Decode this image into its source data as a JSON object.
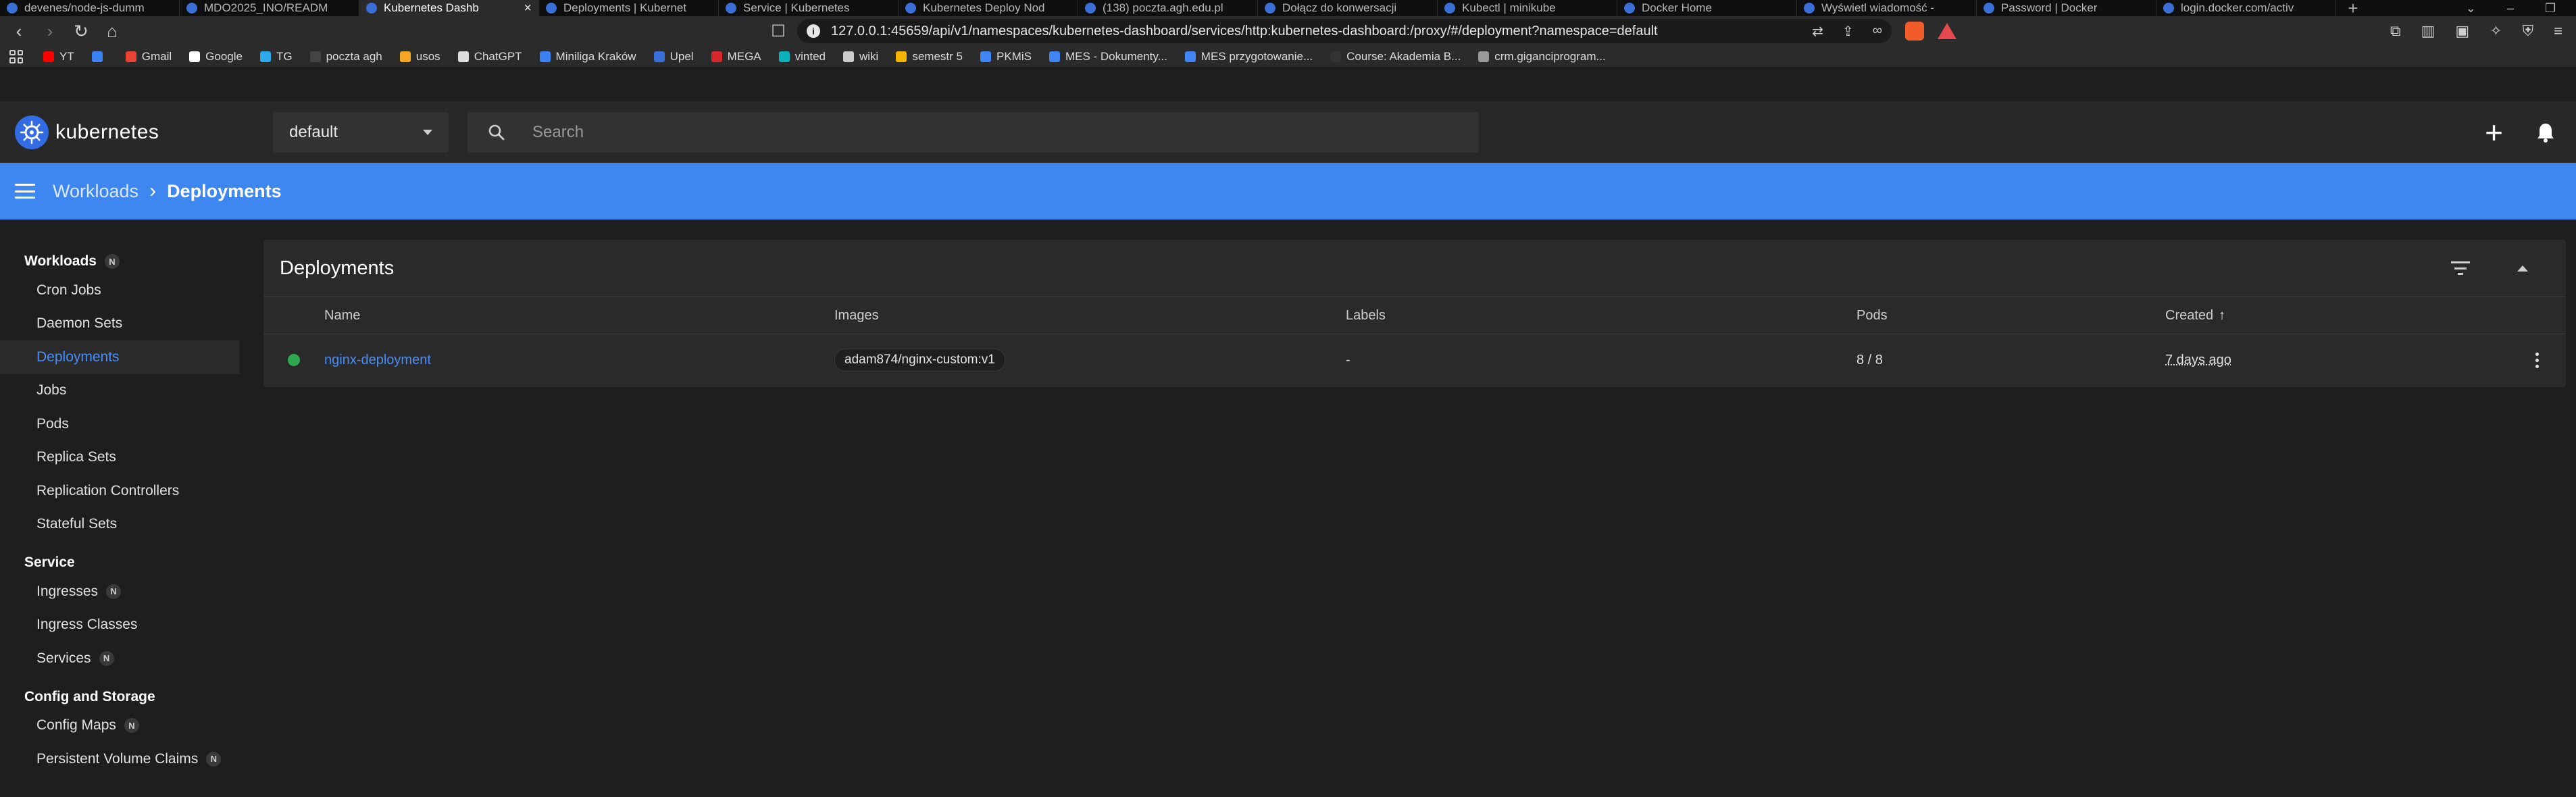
{
  "browser": {
    "tabs": [
      {
        "label": "devenes/node-js-dumm"
      },
      {
        "label": "MDO2025_INO/READM"
      },
      {
        "label": "Kubernetes Dashb",
        "active": true
      },
      {
        "label": "Deployments | Kubernet"
      },
      {
        "label": "Service | Kubernetes"
      },
      {
        "label": "Kubernetes Deploy Nod"
      },
      {
        "label": "(138) poczta.agh.edu.pl"
      },
      {
        "label": "Dołącz do konwersacji"
      },
      {
        "label": "Kubectl | minikube"
      },
      {
        "label": "Docker Home"
      },
      {
        "label": "Wyświetl wiadomość - "
      },
      {
        "label": "Password | Docker"
      },
      {
        "label": "login.docker.com/activ"
      }
    ],
    "tab_close_glyph": "×",
    "new_tab_glyph": "+",
    "url": "127.0.0.1:45659/api/v1/namespaces/kubernetes-dashboard/services/http:kubernetes-dashboard:/proxy/#/deployment?namespace=default",
    "bookmarks": [
      {
        "label": "YT",
        "color": "#ff0000"
      },
      {
        "label": "",
        "color": "#3b82f6"
      },
      {
        "label": "Gmail",
        "color": "#ea4335"
      },
      {
        "label": "Google",
        "color": "#ffffff"
      },
      {
        "label": "TG",
        "color": "#2aabee"
      },
      {
        "label": "poczta agh",
        "color": "#444444"
      },
      {
        "label": "usos",
        "color": "#f5a623"
      },
      {
        "label": "ChatGPT",
        "color": "#dddddd"
      },
      {
        "label": "Miniliga Kraków",
        "color": "#3b82f6"
      },
      {
        "label": "Upel",
        "color": "#3b6fd8"
      },
      {
        "label": "MEGA",
        "color": "#d9272e"
      },
      {
        "label": "vinted",
        "color": "#09b1ba"
      },
      {
        "label": "wiki",
        "color": "#cccccc"
      },
      {
        "label": "semestr 5",
        "color": "#f4b400"
      },
      {
        "label": "PKMiS",
        "color": "#4285f4"
      },
      {
        "label": "MES - Dokumenty...",
        "color": "#4285f4"
      },
      {
        "label": "MES przygotowanie...",
        "color": "#4285f4"
      },
      {
        "label": "Course: Akademia B...",
        "color": "#333333"
      },
      {
        "label": "crm.gigancіprogram...",
        "color": "#999999"
      }
    ]
  },
  "header": {
    "logo_text": "kubernetes",
    "namespace": "default",
    "search_placeholder": "Search"
  },
  "breadcrumb": {
    "parent": "Workloads",
    "separator": "›",
    "current": "Deployments"
  },
  "sidebar": {
    "sections": [
      {
        "title": "Workloads",
        "badge": "N",
        "items": [
          {
            "label": "Cron Jobs"
          },
          {
            "label": "Daemon Sets"
          },
          {
            "label": "Deployments",
            "active": true
          },
          {
            "label": "Jobs"
          },
          {
            "label": "Pods"
          },
          {
            "label": "Replica Sets"
          },
          {
            "label": "Replication Controllers"
          },
          {
            "label": "Stateful Sets"
          }
        ]
      },
      {
        "title": "Service",
        "items": [
          {
            "label": "Ingresses",
            "badge": "N"
          },
          {
            "label": "Ingress Classes"
          },
          {
            "label": "Services",
            "badge": "N"
          }
        ]
      },
      {
        "title": "Config and Storage",
        "items": [
          {
            "label": "Config Maps",
            "badge": "N"
          },
          {
            "label": "Persistent Volume Claims",
            "badge": "N"
          }
        ]
      }
    ]
  },
  "card": {
    "title": "Deployments",
    "columns": {
      "name": "Name",
      "images": "Images",
      "labels": "Labels",
      "pods": "Pods",
      "created": "Created",
      "sort_arrow": "↑"
    },
    "rows": [
      {
        "status": "running",
        "name": "nginx-deployment",
        "image": "adam874/nginx-custom:v1",
        "labels": "-",
        "pods": "8 / 8",
        "created": "7 days ago"
      }
    ]
  },
  "colors": {
    "accent_blue": "#3e86f0",
    "link_blue": "#4a8ff5",
    "status_green": "#2fa84f",
    "header_bg": "#282828",
    "page_bg": "#1e1e1e"
  }
}
